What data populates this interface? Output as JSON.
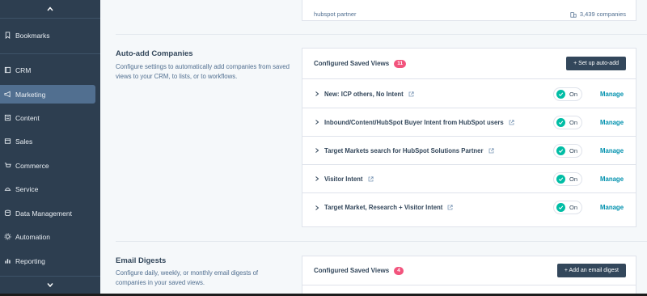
{
  "sidebar": {
    "items": [
      {
        "label": "Bookmarks",
        "icon": "bookmark-icon"
      },
      {
        "label": "CRM",
        "icon": "crm-icon"
      },
      {
        "label": "Marketing",
        "icon": "megaphone-icon",
        "active": true
      },
      {
        "label": "Content",
        "icon": "content-icon"
      },
      {
        "label": "Sales",
        "icon": "sales-icon"
      },
      {
        "label": "Commerce",
        "icon": "commerce-icon"
      },
      {
        "label": "Service",
        "icon": "service-icon"
      },
      {
        "label": "Data Management",
        "icon": "database-icon"
      },
      {
        "label": "Automation",
        "icon": "automation-icon"
      },
      {
        "label": "Reporting",
        "icon": "reporting-icon"
      }
    ]
  },
  "top_card": {
    "left_text": "hubspot partner",
    "right_text": "3,439 companies"
  },
  "auto_add": {
    "title": "Auto-add Companies",
    "description": "Configure settings to automatically add companies from saved views to your CRM, to lists, or to workflows.",
    "card_title": "Configured Saved Views",
    "badge": "11",
    "button_label": "+ Set up auto-add",
    "rows": [
      {
        "label": "New: ICP others, No Intent",
        "status": "On",
        "action": "Manage"
      },
      {
        "label": "Inbound/Content/HubSpot Buyer Intent from HubSpot users",
        "status": "On",
        "action": "Manage"
      },
      {
        "label": "Target Markets search for HubSpot Solutions Partner",
        "status": "On",
        "action": "Manage"
      },
      {
        "label": "Visitor Intent",
        "status": "On",
        "action": "Manage"
      },
      {
        "label": "Target Market, Research + Visitor Intent",
        "status": "On",
        "action": "Manage"
      }
    ]
  },
  "email_digests": {
    "title": "Email Digests",
    "description": "Configure daily, weekly, or monthly email digests of companies in your saved views.",
    "card_title": "Configured Saved Views",
    "badge": "4",
    "button_label": "+ Add an email digest"
  },
  "colors": {
    "sidebar_bg": "#2d3e50",
    "sidebar_active": "#516f90",
    "accent_badge": "#f2547d",
    "toggle_on": "#00bda5",
    "link": "#0091ae"
  }
}
